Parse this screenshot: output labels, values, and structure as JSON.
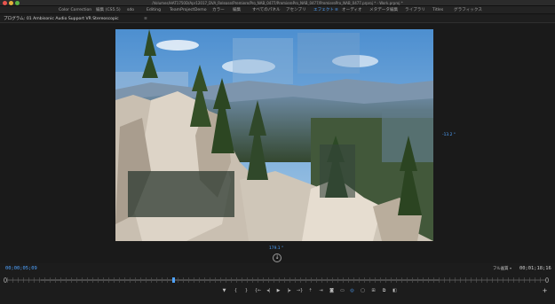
{
  "window": {
    "title": "/Volumes/HAT1750D/Apr12017_DVA_Release/Premiere/Pro_NAB_0477/PremierePro_NAB_0477/PremierePro_NAB_0477.prproj * - Work.prproj *"
  },
  "workspaces": {
    "tabs": [
      {
        "label": "Color Correction",
        "active": false
      },
      {
        "label": "編集 (CS5.5)",
        "active": false
      },
      {
        "label": "sdo",
        "active": false
      },
      {
        "label": "Editing",
        "active": false
      },
      {
        "label": "TeamProjectDemo",
        "active": false
      },
      {
        "label": "カラー",
        "active": false
      },
      {
        "label": "編集",
        "active": false
      },
      {
        "label": "すべてのパネル",
        "active": false
      },
      {
        "label": "アセンブリ",
        "active": false
      },
      {
        "label": "エフェクト",
        "active": true
      },
      {
        "label": "オーディオ",
        "active": false
      },
      {
        "label": "メタデータ編集",
        "active": false
      },
      {
        "label": "ライブラリ",
        "active": false
      },
      {
        "label": "Titles",
        "active": false
      },
      {
        "label": "グラフィックス",
        "active": false
      }
    ],
    "active_menu_icon": "≡"
  },
  "panel": {
    "title": "プログラム: 01 Ambisonic Audio Support VR Stereoscopic",
    "menu_icon": "≡"
  },
  "monitor": {
    "vr_rotation_vertical": "-13.2 °",
    "vr_rotation_horizontal": "179.1 °",
    "orientation_icon": "↓"
  },
  "timecode": {
    "current": "00;00;05;09",
    "duration": "00;01;18;16"
  },
  "fit": {
    "selected": "フル画質",
    "arrow": "▾"
  },
  "transport": {
    "buttons": [
      {
        "name": "add-marker-button",
        "glyph": "▼"
      },
      {
        "name": "mark-in-button",
        "glyph": "{"
      },
      {
        "name": "mark-out-button",
        "glyph": "}"
      },
      {
        "name": "go-to-in-button",
        "glyph": "{←"
      },
      {
        "name": "step-back-button",
        "glyph": "◂|"
      },
      {
        "name": "play-button",
        "glyph": "▶"
      },
      {
        "name": "step-forward-button",
        "glyph": "|▸"
      },
      {
        "name": "go-to-out-button",
        "glyph": "→}"
      },
      {
        "name": "lift-button",
        "glyph": "⇡"
      },
      {
        "name": "extract-button",
        "glyph": "⇥"
      },
      {
        "name": "export-frame-button",
        "glyph": "◙"
      },
      {
        "name": "comparison-view-button",
        "glyph": "▭"
      },
      {
        "name": "vr-video-button",
        "glyph": "◎"
      },
      {
        "name": "safe-margins-button",
        "glyph": "▢"
      },
      {
        "name": "multicam-button",
        "glyph": "⊞"
      },
      {
        "name": "proxy-toggle-button",
        "glyph": "⧉"
      },
      {
        "name": "settings-button",
        "glyph": "◧"
      }
    ],
    "add_button": "+"
  },
  "colors": {
    "accent": "#4fa3ff",
    "background": "#1c1c1c"
  }
}
